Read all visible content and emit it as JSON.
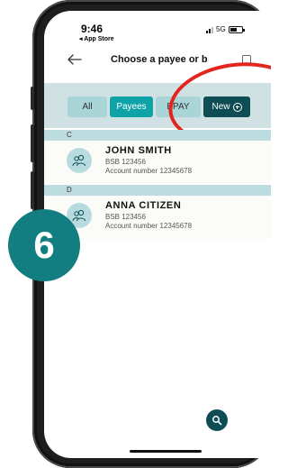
{
  "status_bar": {
    "time": "9:46",
    "back_app_label": "◂ App Store",
    "network": "5G"
  },
  "nav": {
    "title": "Choose a payee or b"
  },
  "tabs": [
    {
      "label": "All",
      "active": false
    },
    {
      "label": "Payees",
      "active": true
    },
    {
      "label": "BPAY",
      "active": false
    }
  ],
  "new_button": {
    "label": "New"
  },
  "sections": [
    {
      "letter": "C",
      "payees": [
        {
          "name": "JOHN SMITH",
          "bsb": "BSB 123456",
          "account": "Account number 12345678"
        }
      ]
    },
    {
      "letter": "D",
      "payees": [
        {
          "name": "ANNA CITIZEN",
          "bsb": "BSB 123456",
          "account": "Account number 12345678"
        }
      ]
    }
  ],
  "step_badge": "6",
  "colors": {
    "accent": "#0fa3a8",
    "dark_teal": "#0d4d53",
    "panel": "#cfe1e3",
    "badge": "#137e82",
    "annotation": "#e3261d"
  },
  "icons": {
    "back": "back-arrow-icon",
    "avatar": "person-group-icon",
    "new": "plus-circle-icon",
    "search": "search-icon"
  }
}
